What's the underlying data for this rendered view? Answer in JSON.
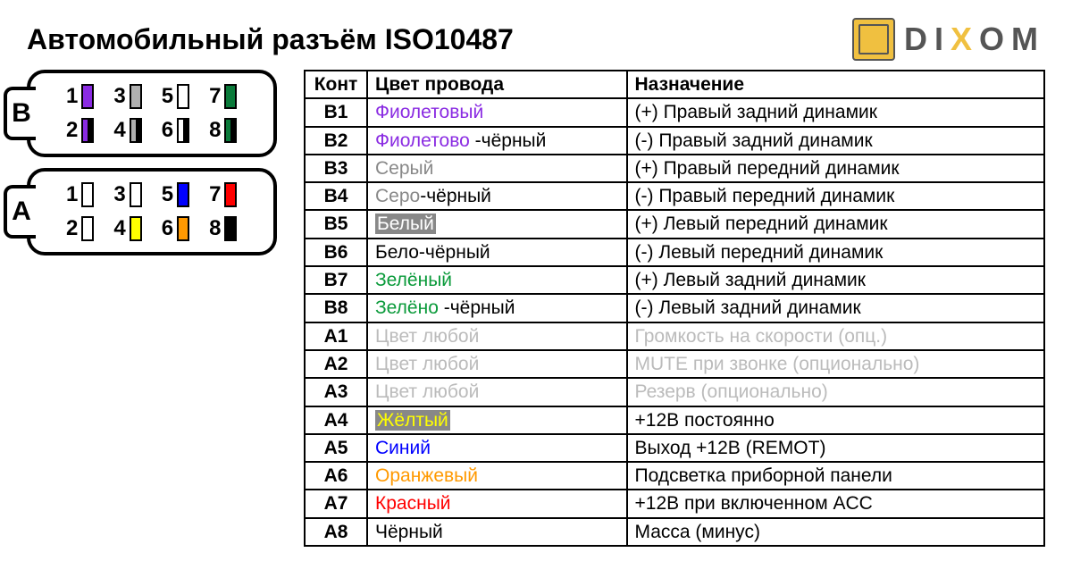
{
  "title": "Автомобильный разъём ISO10487",
  "brand": {
    "d": "D",
    "i": "I",
    "x": "X",
    "o": "O",
    "m": "M"
  },
  "headers": {
    "contact": "Конт",
    "color": "Цвет провода",
    "purpose": "Назначение"
  },
  "connector": {
    "B": {
      "row1": [
        {
          "n": "1",
          "c1": "#8a2be2",
          "c2": "#8a2be2"
        },
        {
          "n": "3",
          "c1": "#b0b0b0",
          "c2": "#b0b0b0"
        },
        {
          "n": "5",
          "c1": "#ffffff",
          "c2": "#ffffff"
        },
        {
          "n": "7",
          "c1": "#0a7a3a",
          "c2": "#0a7a3a"
        }
      ],
      "row2": [
        {
          "n": "2",
          "c1": "#8a2be2",
          "c2": "#000000"
        },
        {
          "n": "4",
          "c1": "#b0b0b0",
          "c2": "#000000"
        },
        {
          "n": "6",
          "c1": "#ffffff",
          "c2": "#000000"
        },
        {
          "n": "8",
          "c1": "#0a7a3a",
          "c2": "#000000"
        }
      ]
    },
    "A": {
      "row1": [
        {
          "n": "1",
          "c1": "#ffffff",
          "c2": "#ffffff"
        },
        {
          "n": "3",
          "c1": "#ffffff",
          "c2": "#ffffff"
        },
        {
          "n": "5",
          "c1": "#0000ff",
          "c2": "#0000ff"
        },
        {
          "n": "7",
          "c1": "#ff0000",
          "c2": "#ff0000"
        }
      ],
      "row2": [
        {
          "n": "2",
          "c1": "#ffffff",
          "c2": "#ffffff"
        },
        {
          "n": "4",
          "c1": "#ffff00",
          "c2": "#ffff00"
        },
        {
          "n": "6",
          "c1": "#ff9900",
          "c2": "#ff9900"
        },
        {
          "n": "8",
          "c1": "#000000",
          "c2": "#000000"
        }
      ]
    }
  },
  "rows": [
    {
      "pin": "B1",
      "color_html": "<span style='color:#8a2be2'>Фиолетовый</span>",
      "purpose": "(+) Правый задний динамик"
    },
    {
      "pin": "B2",
      "color_html": "<span style='color:#8a2be2'>Фиолетово</span> -чёрный",
      "purpose": "(-)  Правый задний динамик"
    },
    {
      "pin": "B3",
      "color_html": "<span style='color:#888'>Серый</span>",
      "purpose": "(+) Правый передний динамик"
    },
    {
      "pin": "B4",
      "color_html": "<span style='color:#888'>Серо</span>-чёрный",
      "purpose": "(-)  Правый передний динамик"
    },
    {
      "pin": "B5",
      "color_html": "<span class='hl-gray'>Белый</span>",
      "purpose": "(+) Левый передний динамик"
    },
    {
      "pin": "B6",
      "color_html": "Бело-чёрный",
      "purpose": "(-)  Левый передний динамик"
    },
    {
      "pin": "B7",
      "color_html": "<span style='color:#0a9a3a'>Зелёный</span>",
      "purpose": "(+) Левый задний динамик"
    },
    {
      "pin": "B8",
      "color_html": "<span style='color:#0a9a3a'>Зелёно</span> -чёрный",
      "purpose": "(-)  Левый задний динамик"
    },
    {
      "pin": "A1",
      "color_html": "<span class='faded'>Цвет любой</span>",
      "purpose": "<span class='faded'>Громкость на скорости (опц.)</span>"
    },
    {
      "pin": "A2",
      "color_html": "<span class='faded'>Цвет любой</span>",
      "purpose": "<span class='faded'>MUTE при звонке (опционально)</span>"
    },
    {
      "pin": "A3",
      "color_html": "<span class='faded'>Цвет любой</span>",
      "purpose": "<span class='faded'>Резерв (опционально)</span>"
    },
    {
      "pin": "A4",
      "color_html": "<span class='hl-yellow'>Жёлтый</span>",
      "purpose": "+12В постоянно"
    },
    {
      "pin": "A5",
      "color_html": "<span style='color:#0000ff'>Синий</span>",
      "purpose": "Выход +12В (REMOT)"
    },
    {
      "pin": "A6",
      "color_html": "<span style='color:#ff9900'>Оранжевый</span>",
      "purpose": "Подсветка приборной панели"
    },
    {
      "pin": "A7",
      "color_html": "<span style='color:#ff0000'>Красный</span>",
      "purpose": "+12В при включенном ACC"
    },
    {
      "pin": "A8",
      "color_html": "Чёрный",
      "purpose": "Масса (минус)"
    }
  ]
}
